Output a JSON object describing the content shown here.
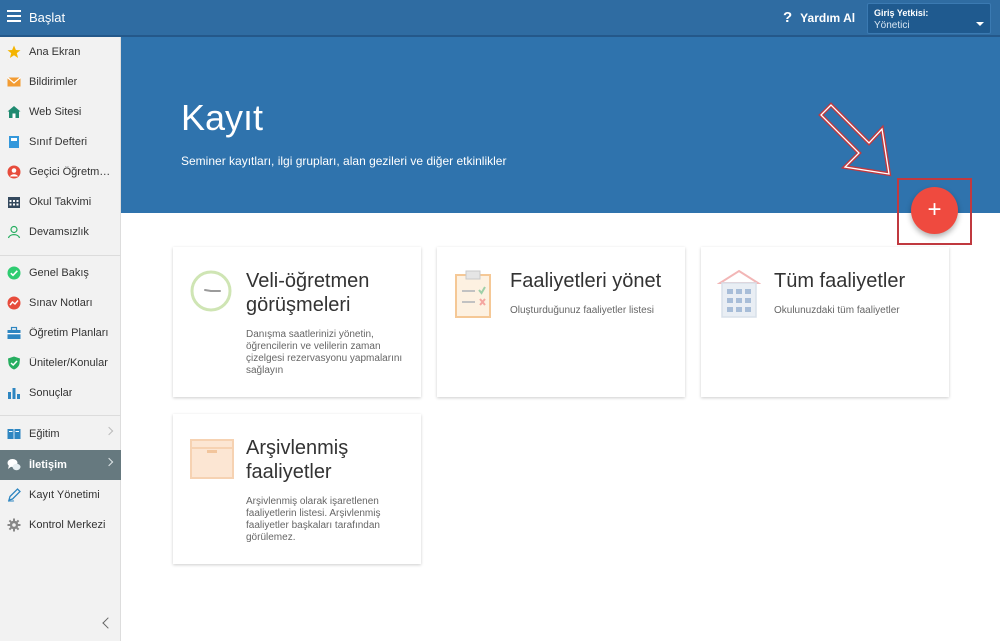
{
  "topbar": {
    "title": "Başlat",
    "help_label": "Yardım Al",
    "role_label": "Giriş Yetkisi:",
    "role_value": "Yönetici"
  },
  "sidebar": {
    "items": [
      {
        "label": "Ana Ekran",
        "icon": "star-icon"
      },
      {
        "label": "Bildirimler",
        "icon": "envelope-icon"
      },
      {
        "label": "Web Sitesi",
        "icon": "house-icon"
      },
      {
        "label": "Sınıf Defteri",
        "icon": "notebook-icon"
      },
      {
        "label": "Geçici Öğretmenler",
        "icon": "person-badge-icon"
      },
      {
        "label": "Okul Takvimi",
        "icon": "calendar-icon"
      },
      {
        "label": "Devamsızlık",
        "icon": "person-outline-icon"
      },
      {
        "label": "Genel Bakış",
        "icon": "check-circle-icon"
      },
      {
        "label": "Sınav Notları",
        "icon": "chart-circle-icon"
      },
      {
        "label": "Öğretim Planları",
        "icon": "briefcase-icon"
      },
      {
        "label": "Üniteler/Konular",
        "icon": "shield-check-icon"
      },
      {
        "label": "Sonuçlar",
        "icon": "bar-chart-icon"
      },
      {
        "label": "Eğitim",
        "icon": "book-icon"
      },
      {
        "label": "İletişim",
        "icon": "chat-icon"
      },
      {
        "label": "Kayıt Yönetimi",
        "icon": "pen-icon"
      },
      {
        "label": "Kontrol Merkezi",
        "icon": "gear-icon"
      }
    ]
  },
  "hero": {
    "title": "Kayıt",
    "subtitle": "Seminer kayıtları, ilgi grupları, alan gezileri ve diğer etkinlikler",
    "fab_label": "+"
  },
  "cards": [
    {
      "title": "Veli-öğretmen görüşmeleri",
      "description": "Danışma saatlerinizi yönetin, öğrencilerin ve velilerin zaman çizelgesi rezervasyonu yapmalarını sağlayın",
      "icon": "clock-icon"
    },
    {
      "title": "Faaliyetleri yönet",
      "description": "Oluşturduğunuz faaliyetler listesi",
      "icon": "clipboard-icon"
    },
    {
      "title": "Tüm faaliyetler",
      "description": "Okulunuzdaki tüm faaliyetler",
      "icon": "building-icon"
    },
    {
      "title": "Arşivlenmiş faaliyetler",
      "description": "Arşivlenmiş olarak işaretlenen faaliyetlerin listesi. Arşivlenmiş faaliyetler başkaları tarafından görülemez.",
      "icon": "archive-box-icon"
    }
  ],
  "colors": {
    "topbar": "#2f6ca2",
    "hero": "#2f73ad",
    "fab": "#ef4a3f",
    "active_nav": "#66797f",
    "highlight": "#c0393f"
  }
}
